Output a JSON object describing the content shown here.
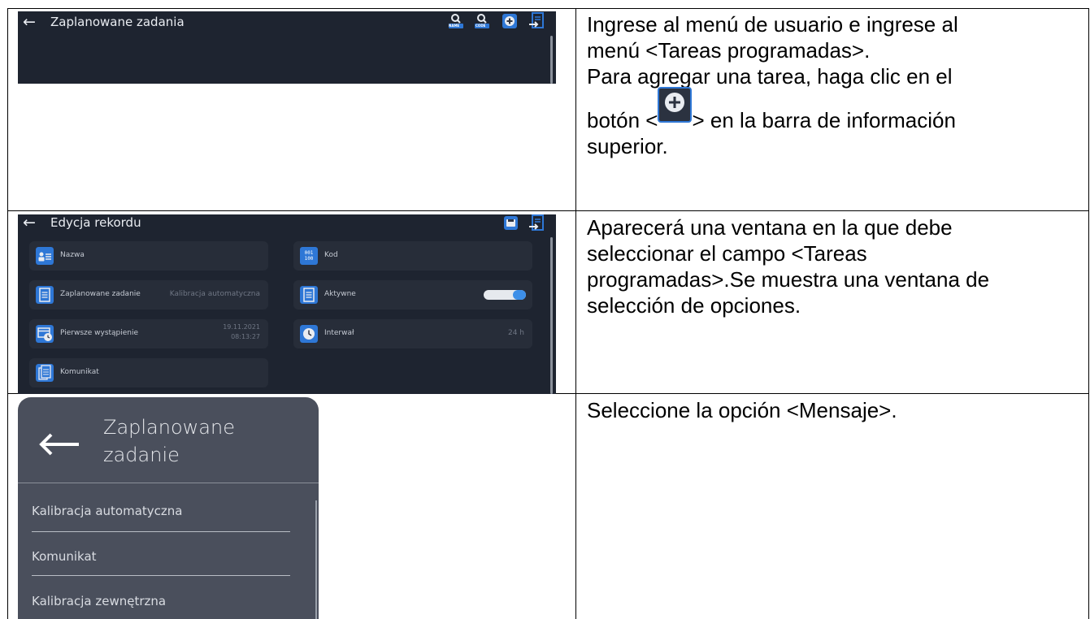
{
  "screens": {
    "screen1": {
      "title": "Zaplanowane zadania",
      "toolbar_icons": [
        "search-name-icon",
        "search-code-icon",
        "add-icon",
        "exit-icon"
      ],
      "search_name_badge": "NAME",
      "search_code_badge": "CODE"
    },
    "screen2": {
      "title": "Edycja rekordu",
      "fields": {
        "name_label": "Nazwa",
        "code_label": "Kod",
        "code_icon_text": "001 100",
        "task_label": "Zaplanowane zadanie",
        "task_value": "Kalibracja automatyczna",
        "active_label": "Aktywne",
        "active_state": true,
        "first_occurrence_label": "Pierwsze wystąpienie",
        "first_occurrence_date": "19.11.2021",
        "first_occurrence_time": "08:13:27",
        "interval_label": "Interwał",
        "interval_value": "24 h",
        "message_label": "Komunikat"
      }
    },
    "screen3": {
      "title_line1": "Zaplanowane",
      "title_line2": "zadanie",
      "options": [
        "Kalibracja automatyczna",
        "Komunikat",
        "Kalibracja zewnętrzna"
      ]
    }
  },
  "instructions": {
    "step1": {
      "line1": "Ingrese al menú de usuario e ingrese al",
      "line2": "menú <Tareas programadas>.",
      "line3": "Para agregar una tarea, haga clic en el",
      "line4_before": "botón <",
      "line4_after": "> en la barra de información",
      "line5": "superior."
    },
    "step2": {
      "line1": "Aparecerá una ventana en la que debe",
      "line2": "seleccionar el campo <Tareas",
      "line3": "programadas>.Se muestra una ventana de",
      "line4": "selección de opciones."
    },
    "step3": {
      "line1": "Seleccione la opción <Mensaje>."
    }
  },
  "colors": {
    "screen_bg": "#1e2430",
    "tile_bg": "#272d39",
    "accent_blue": "#2e77d6",
    "dialog_bg": "#4a4f5c"
  }
}
